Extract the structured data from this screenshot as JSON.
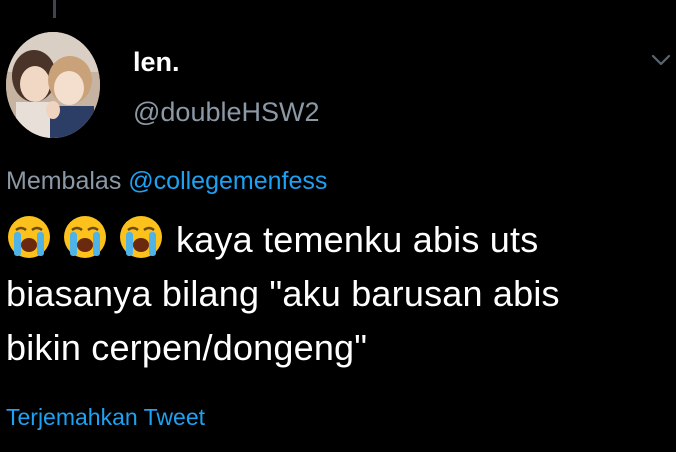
{
  "tweet": {
    "display_name": "len.",
    "handle": "@doubleHSW2",
    "reply_prefix": "Membalas",
    "reply_mention": "@collegemenfess",
    "emoji": [
      "loudly-crying-face",
      "loudly-crying-face",
      "loudly-crying-face"
    ],
    "text_line1": "kaya temenku abis uts",
    "text_line2": "biasanya bilang \"aku barusan abis",
    "text_line3": "bikin cerpen/dongeng\"",
    "translate_label": "Terjemahkan Tweet"
  },
  "colors": {
    "background": "#000000",
    "text_primary": "#ffffff",
    "text_secondary": "#8b98a5",
    "accent": "#1da1f2"
  }
}
